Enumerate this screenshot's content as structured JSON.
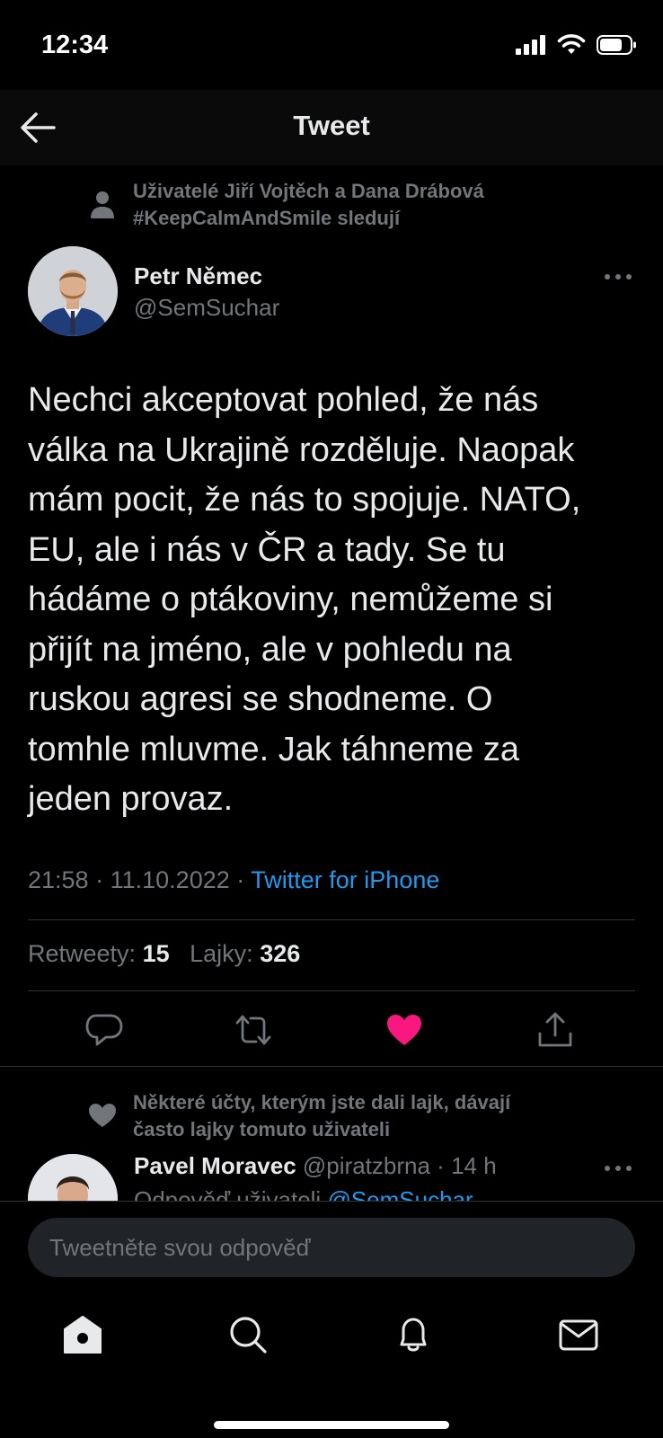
{
  "status_bar": {
    "time": "12:34"
  },
  "header": {
    "title": "Tweet"
  },
  "social_context": {
    "line1": "Uživatelé Jiří Vojtěch a Dana Drábová",
    "line2": "#KeepCalmAndSmile sledují"
  },
  "tweet": {
    "author_name": "Petr Němec",
    "author_handle": "@SemSuchar",
    "text_lines": [
      "Nechci akceptovat pohled, že nás",
      "válka na Ukrajině rozděluje. Naopak",
      "mám pocit, že nás to spojuje. NATO,",
      "EU, ale i nás v ČR a tady. Se tu",
      "hádáme o ptákoviny, nemůžeme si",
      "přijít na jméno, ale v pohledu na",
      "ruskou agresi se shodneme. O",
      "tomhle mluvme. Jak táhneme za",
      "jeden provaz."
    ],
    "time": "21:58",
    "date": "11.10.2022",
    "separator": "·",
    "source": "Twitter for iPhone",
    "retweets_label": "Retweety:",
    "retweets_count": "15",
    "likes_label": "Lajky:",
    "likes_count": "326",
    "liked": true
  },
  "reply_context": {
    "line1": "Některé účty, kterým jste dali lajk, dávají",
    "line2": "často lajky tomuto uživateli"
  },
  "reply": {
    "name": "Pavel Moravec",
    "handle": "@piratzbrna",
    "separator": "·",
    "age": "14 h",
    "sub_prefix": "Odpověď uživateli",
    "sub_mention": "@SemSuchar"
  },
  "reply_input": {
    "placeholder": "Tweetněte svou odpověď"
  },
  "colors": {
    "accent": "#1d9bf0",
    "like": "#f91880",
    "muted": "#71767b",
    "background": "#000000"
  },
  "icons": {
    "back": "arrow-left-icon",
    "person": "person-icon",
    "more": "more-horizontal-icon",
    "reply": "comment-icon",
    "retweet": "retweet-icon",
    "like": "heart-filled-icon",
    "share": "share-icon",
    "nav": [
      "home-icon",
      "search-icon",
      "bell-icon",
      "mail-icon"
    ]
  }
}
